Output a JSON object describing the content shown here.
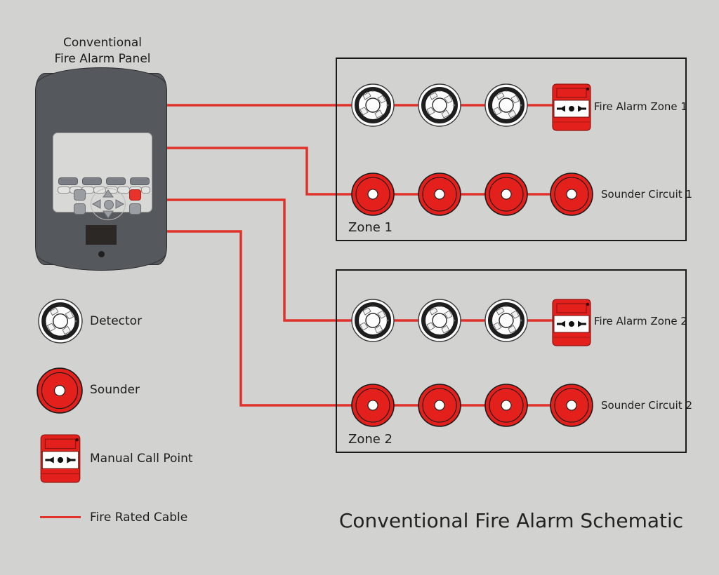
{
  "meta": {
    "background_color": "#d2d2d0",
    "cable_color": "#e0312b",
    "device_red": "#e3201c",
    "panel_gray": "#55585c",
    "outline": "#1a1a1a"
  },
  "diagram": {
    "main_title": "Conventional Fire Alarm Schematic",
    "panel_title_line1": "Conventional",
    "panel_title_line2": "Fire Alarm Panel"
  },
  "zones": [
    {
      "id": "zone1",
      "box_label": "Zone 1",
      "detector_loop_label": "Fire Alarm Zone 1",
      "sounder_loop_label": "Sounder Circuit 1",
      "detector_count": 3,
      "manual_call_points": 1,
      "sounder_count": 4
    },
    {
      "id": "zone2",
      "box_label": "Zone 2",
      "detector_loop_label": "Fire Alarm Zone 2",
      "sounder_loop_label": "Sounder Circuit 2",
      "detector_count": 3,
      "manual_call_points": 1,
      "sounder_count": 4
    }
  ],
  "legend": {
    "items": [
      {
        "symbol": "detector",
        "label": "Detector"
      },
      {
        "symbol": "sounder",
        "label": "Sounder"
      },
      {
        "symbol": "manual-call-point",
        "label": "Manual Call Point"
      },
      {
        "symbol": "cable-line",
        "label": "Fire Rated Cable"
      }
    ]
  },
  "mcp_glyph": "→●←"
}
